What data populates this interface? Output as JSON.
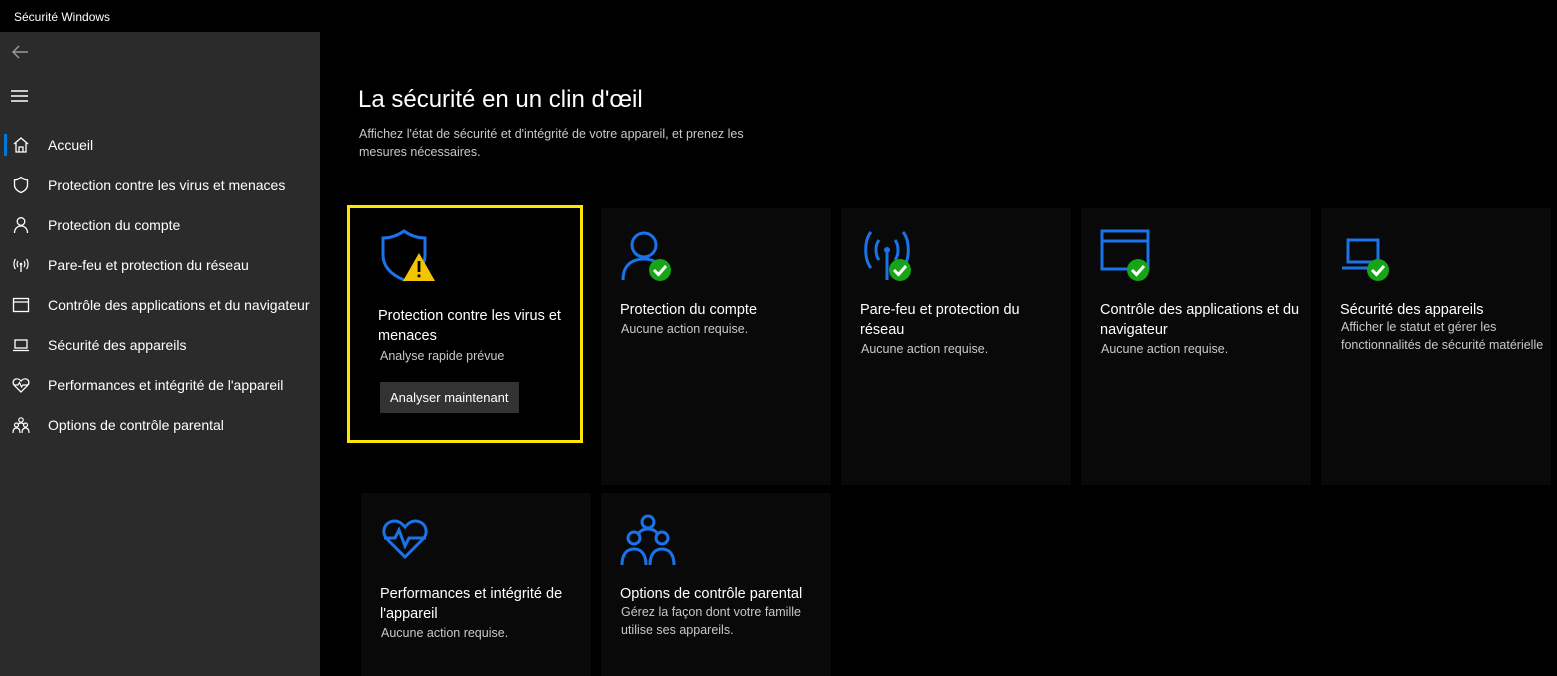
{
  "window": {
    "title": "Sécurité Windows"
  },
  "sidebar": {
    "items": [
      {
        "label": "Accueil",
        "icon": "home-icon",
        "active": true
      },
      {
        "label": "Protection contre les virus et menaces",
        "icon": "shield-icon"
      },
      {
        "label": "Protection du compte",
        "icon": "person-icon"
      },
      {
        "label": "Pare-feu et protection du réseau",
        "icon": "antenna-icon"
      },
      {
        "label": "Contrôle des applications et du navigateur",
        "icon": "browser-window-icon"
      },
      {
        "label": "Sécurité des appareils",
        "icon": "laptop-icon"
      },
      {
        "label": "Performances et intégrité de l'appareil",
        "icon": "heart-pulse-icon"
      },
      {
        "label": "Options de contrôle parental",
        "icon": "family-icon"
      }
    ]
  },
  "main": {
    "title": "La sécurité en un clin d'œil",
    "subtitle": "Affichez l'état de sécurité et d'intégrité de votre appareil, et prenez les mesures nécessaires."
  },
  "cards": [
    {
      "title": "Protection contre les virus et menaces",
      "desc": "Analyse rapide prévue",
      "status": "warning",
      "button": "Analyser maintenant"
    },
    {
      "title": "Protection du compte",
      "desc": "Aucune action requise.",
      "status": "ok"
    },
    {
      "title": "Pare-feu et protection du réseau",
      "desc": "Aucune action requise.",
      "status": "ok"
    },
    {
      "title": "Contrôle des applications et du navigateur",
      "desc": "Aucune action requise.",
      "status": "ok"
    },
    {
      "title": "Sécurité des appareils",
      "desc": "Afficher le statut et gérer les fonctionnalités de sécurité matérielle",
      "status": "ok"
    },
    {
      "title": "Performances et intégrité de l'appareil",
      "desc": "Aucune action requise."
    },
    {
      "title": "Options de contrôle parental",
      "desc": "Gérez la façon dont votre famille utilise ses appareils."
    }
  ],
  "colors": {
    "accent": "#0078d7",
    "icon_blue": "#1a73e8",
    "ok_green": "#16a516",
    "warning_yellow": "#f5c400",
    "highlight_frame": "#ffe600",
    "sidebar_bg": "#2b2b2b"
  }
}
